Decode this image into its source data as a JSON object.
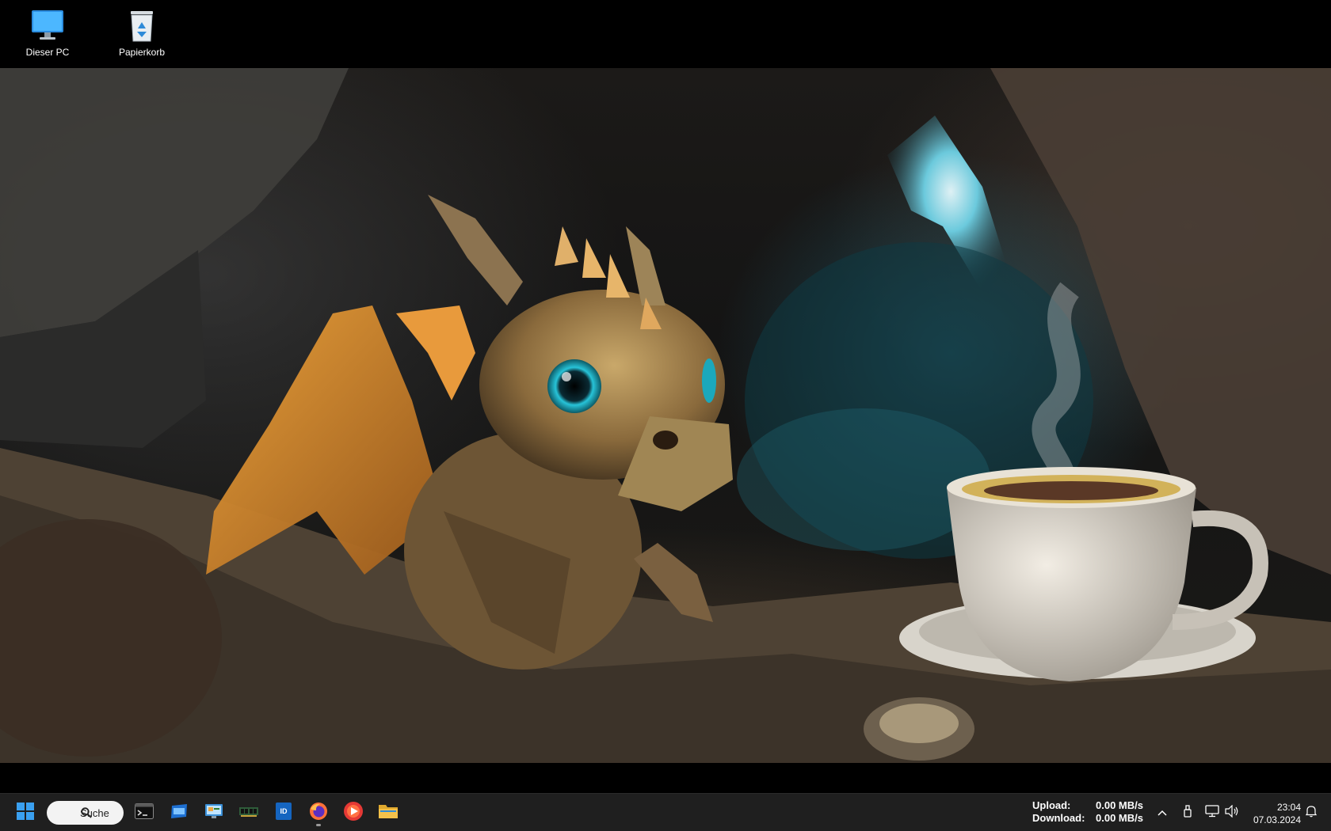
{
  "desktop": {
    "icons": [
      {
        "label": "Dieser PC",
        "icon": "monitor-icon"
      },
      {
        "label": "Papierkorb",
        "icon": "recycle-bin-icon"
      }
    ]
  },
  "taskbar": {
    "search": {
      "label": "Suche"
    },
    "apps": [
      {
        "name": "start",
        "icon": "windows-logo-icon"
      },
      {
        "name": "terminal",
        "icon": "terminal-icon"
      },
      {
        "name": "window-app",
        "icon": "window-icon"
      },
      {
        "name": "control-panel",
        "icon": "control-panel-icon"
      },
      {
        "name": "memory-app",
        "icon": "memory-chip-icon"
      },
      {
        "name": "id-app",
        "icon": "id-badge-icon"
      },
      {
        "name": "firefox",
        "icon": "firefox-icon"
      },
      {
        "name": "media-player",
        "icon": "red-play-icon"
      },
      {
        "name": "file-explorer",
        "icon": "folder-icon"
      }
    ],
    "network": {
      "upload_label": "Upload:",
      "upload_value": "0.00 MB/s",
      "download_label": "Download:",
      "download_value": "0.00 MB/s"
    },
    "tray": [
      "chevron-up-icon",
      "usb-icon",
      "network-icon",
      "volume-icon"
    ],
    "clock": {
      "time": "23:04",
      "date": "07.03.2024"
    },
    "notifications_icon": "bell-icon"
  },
  "colors": {
    "taskbar_bg": "#1f1f1f",
    "accent_blue": "#0a7fd8",
    "folder_yellow": "#f4c14b"
  }
}
